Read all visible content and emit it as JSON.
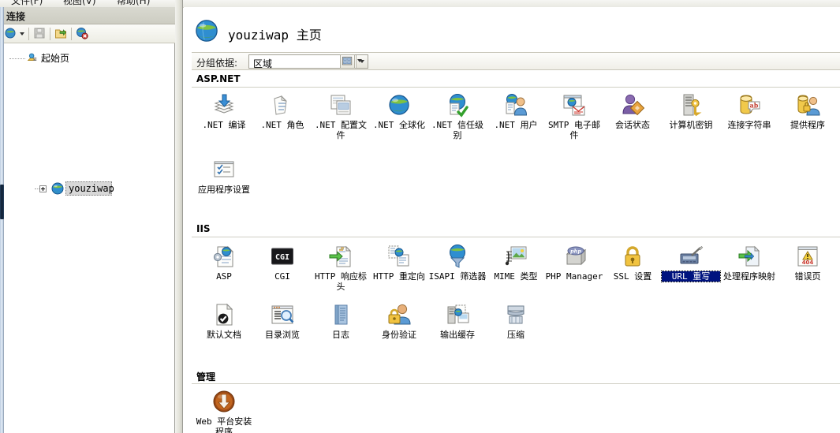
{
  "menubar": {
    "items": [
      "文件(F)",
      "视图(V)",
      "帮助(H)"
    ]
  },
  "sidebar": {
    "title": "连接",
    "toolbar": [
      {
        "name": "connect-dropdown-icon",
        "label": "连接到"
      },
      {
        "name": "save-icon",
        "label": "保存连接"
      },
      {
        "name": "connect-server-icon",
        "label": "连接到服务器"
      },
      {
        "name": "disconnect-icon",
        "label": "断开连接"
      }
    ],
    "tree": {
      "start_page": "起始页",
      "server_node": "youziwap"
    }
  },
  "content": {
    "page_title": "youziwap 主页",
    "groupbar": {
      "label": "分组依据:",
      "value": "区域",
      "view_icon": "view-details-icon"
    },
    "groups": [
      {
        "name": "ASP.NET",
        "items": [
          {
            "label": ".NET 编译",
            "icon": "net-compilation-icon"
          },
          {
            "label": ".NET 角色",
            "icon": "net-roles-icon"
          },
          {
            "label": ".NET 配置文件",
            "icon": "net-profile-icon"
          },
          {
            "label": ".NET 全球化",
            "icon": "net-globalization-icon"
          },
          {
            "label": ".NET 信任级别",
            "icon": "net-trust-levels-icon"
          },
          {
            "label": ".NET 用户",
            "icon": "net-users-icon"
          },
          {
            "label": "SMTP 电子邮件",
            "icon": "smtp-email-icon"
          },
          {
            "label": "会话状态",
            "icon": "session-state-icon"
          },
          {
            "label": "计算机密钥",
            "icon": "machine-key-icon"
          },
          {
            "label": "连接字符串",
            "icon": "connection-strings-icon"
          },
          {
            "label": "提供程序",
            "icon": "providers-icon"
          },
          {
            "label": "应用程序设置",
            "icon": "application-settings-icon"
          }
        ]
      },
      {
        "name": "IIS",
        "items": [
          {
            "label": "ASP",
            "icon": "asp-icon"
          },
          {
            "label": "CGI",
            "icon": "cgi-icon"
          },
          {
            "label": "HTTP 响应标头",
            "icon": "http-response-headers-icon"
          },
          {
            "label": "HTTP 重定向",
            "icon": "http-redirect-icon"
          },
          {
            "label": "ISAPI 筛选器",
            "icon": "isapi-filters-icon"
          },
          {
            "label": "MIME 类型",
            "icon": "mime-types-icon"
          },
          {
            "label": "PHP Manager",
            "icon": "php-manager-icon"
          },
          {
            "label": "SSL 设置",
            "icon": "ssl-settings-icon"
          },
          {
            "label": "URL 重写",
            "icon": "url-rewrite-icon",
            "selected": true
          },
          {
            "label": "处理程序映射",
            "icon": "handler-mappings-icon"
          },
          {
            "label": "错误页",
            "icon": "error-pages-icon"
          },
          {
            "label": "默认文档",
            "icon": "default-document-icon"
          },
          {
            "label": "目录浏览",
            "icon": "directory-browsing-icon"
          },
          {
            "label": "日志",
            "icon": "logging-icon"
          },
          {
            "label": "身份验证",
            "icon": "authentication-icon"
          },
          {
            "label": "输出缓存",
            "icon": "output-caching-icon"
          },
          {
            "label": "压缩",
            "icon": "compression-icon"
          }
        ]
      },
      {
        "name": "管理",
        "items": [
          {
            "label": "Web 平台安装程序",
            "icon": "web-platform-installer-icon"
          }
        ]
      }
    ]
  },
  "colors": {
    "selection_blue": "#00137f",
    "group_header_text": "#000000",
    "pane_border": "#9b9b94"
  }
}
